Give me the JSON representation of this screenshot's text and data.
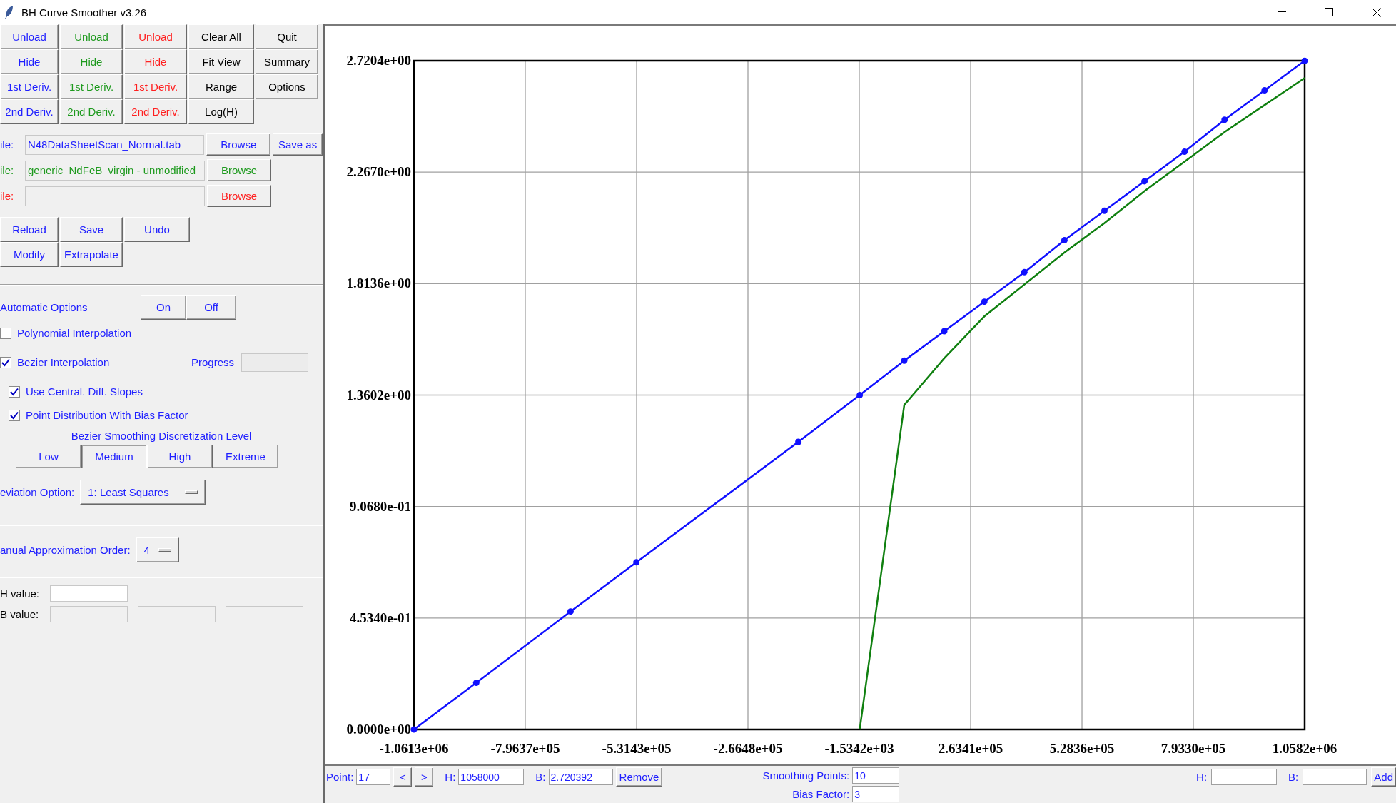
{
  "window": {
    "title": "BH Curve Smoother v3.26"
  },
  "button_rows": [
    [
      {
        "label": "Unload",
        "color": "#2020ff"
      },
      {
        "label": "Unload",
        "color": "#1e9a1e"
      },
      {
        "label": "Unload",
        "color": "#ff2020"
      },
      {
        "label": "Clear All",
        "color": "#000000"
      },
      {
        "label": "Quit",
        "color": "#000000"
      }
    ],
    [
      {
        "label": "Hide",
        "color": "#2020ff"
      },
      {
        "label": "Hide",
        "color": "#1e9a1e"
      },
      {
        "label": "Hide",
        "color": "#ff2020"
      },
      {
        "label": "Fit View",
        "color": "#000000"
      },
      {
        "label": "Summary",
        "color": "#000000"
      }
    ],
    [
      {
        "label": "1st Deriv.",
        "color": "#2020ff"
      },
      {
        "label": "1st Deriv.",
        "color": "#1e9a1e"
      },
      {
        "label": "1st Deriv.",
        "color": "#ff2020"
      },
      {
        "label": "Range",
        "color": "#000000"
      },
      {
        "label": "Options",
        "color": "#000000"
      }
    ],
    [
      {
        "label": "2nd Deriv.",
        "color": "#2020ff"
      },
      {
        "label": "2nd Deriv.",
        "color": "#1e9a1e"
      },
      {
        "label": "2nd Deriv.",
        "color": "#ff2020"
      },
      {
        "label": "Log(H)",
        "color": "#000000"
      }
    ]
  ],
  "files": [
    {
      "label": "ile:",
      "value": "N48DataSheetScan_Normal.tab",
      "color": "#2020ff",
      "buttons": [
        "Browse",
        "Save as"
      ]
    },
    {
      "label": "ile:",
      "value": "generic_NdFeB_virgin - unmodified",
      "color": "#1e9a1e",
      "buttons": [
        "Browse"
      ]
    },
    {
      "label": "ile:",
      "color": "#ff2020",
      "buttons": [
        "Browse"
      ]
    }
  ],
  "file_actions": [
    [
      "Reload",
      "Save",
      "Undo"
    ],
    [
      "Modify",
      "Extrapolate"
    ]
  ],
  "automatic_options": {
    "label": "Automatic Options",
    "buttons": [
      "On",
      "Off"
    ]
  },
  "options": [
    {
      "label": "Polynomial Interpolation",
      "checked": false
    },
    {
      "label": "Bezier Interpolation",
      "checked": true,
      "children": [
        {
          "label": "Use Central. Diff. Slopes",
          "checked": true
        },
        {
          "label": "Point Distribution With Bias Factor",
          "checked": true
        }
      ]
    }
  ],
  "progress": {
    "label": "Progress"
  },
  "discretization": {
    "title": "Bezier Smoothing Discretization Level",
    "levels": [
      {
        "label": "Low",
        "selected": false
      },
      {
        "label": "Medium",
        "selected": true
      },
      {
        "label": "High",
        "selected": false
      },
      {
        "label": "Extreme",
        "selected": false
      }
    ]
  },
  "deviation_option": {
    "label": "eviation Option:",
    "value": "1: Least Squares"
  },
  "approximation_order": {
    "label": "anual Approximation Order:",
    "value": "4"
  },
  "h_value": {
    "label": "H value:"
  },
  "b_value": {
    "label": "B value:"
  },
  "chart_data": {
    "type": "line",
    "x": [
      -1061300,
      -913080,
      -688640,
      -531950,
      -146580,
      -483,
      105370,
      200650,
      295930,
      391220,
      486500,
      581780,
      677060,
      772350,
      867630,
      962910,
      1058200
    ],
    "series": [
      {
        "color": "#1010ff",
        "marker": "circle",
        "values": [
          0,
          0.19,
          0.48,
          0.68,
          1.17,
          1.36,
          1.5,
          1.62,
          1.74,
          1.86,
          1.99,
          2.11,
          2.23,
          2.35,
          2.48,
          2.6,
          2.72
        ]
      },
      {
        "color": "#108010",
        "marker": "none",
        "values": [
          null,
          null,
          null,
          null,
          null,
          0,
          1.32,
          1.51,
          1.68,
          1.81,
          1.94,
          2.06,
          2.19,
          2.31,
          2.43,
          2.54,
          2.65
        ]
      }
    ],
    "grid": true,
    "xlim": [
      -1061300,
      1058200
    ],
    "ylim": [
      0,
      2.7204
    ],
    "xticks": [
      {
        "value": -1061300,
        "label": "-1.0613e+06"
      },
      {
        "value": -796370,
        "label": "-7.9637e+05"
      },
      {
        "value": -531430,
        "label": "-5.3143e+05"
      },
      {
        "value": -266480,
        "label": "-2.6648e+05"
      },
      {
        "value": -1534.2,
        "label": "-1.5342e+03"
      },
      {
        "value": 263410,
        "label": "2.6341e+05"
      },
      {
        "value": 528360,
        "label": "5.2836e+05"
      },
      {
        "value": 793300,
        "label": "7.9330e+05"
      },
      {
        "value": 1058200,
        "label": "1.0582e+06"
      }
    ],
    "yticks": [
      {
        "value": 0,
        "label": "0.0000e+00"
      },
      {
        "value": 0.4534,
        "label": "4.5340e-01"
      },
      {
        "value": 0.9068,
        "label": "9.0680e-01"
      },
      {
        "value": 1.3602,
        "label": "1.3602e+00"
      },
      {
        "value": 1.8136,
        "label": "1.8136e+00"
      },
      {
        "value": 2.267,
        "label": "2.2670e+00"
      },
      {
        "value": 2.7204,
        "label": "2.7204e+00"
      }
    ]
  },
  "point_bar": {
    "point_label": "Point:",
    "point": "17",
    "prev": "<",
    "next": ">",
    "h_label": "H:",
    "h": "1058000",
    "b_label": "B:",
    "b": "2.720392",
    "remove": "Remove",
    "smoothing_label": "Smoothing Points:",
    "smoothing": "10",
    "bias_label": "Bias Factor:",
    "bias": "3",
    "new_h_label": "H:",
    "new_b_label": "B:",
    "add": "Add"
  }
}
